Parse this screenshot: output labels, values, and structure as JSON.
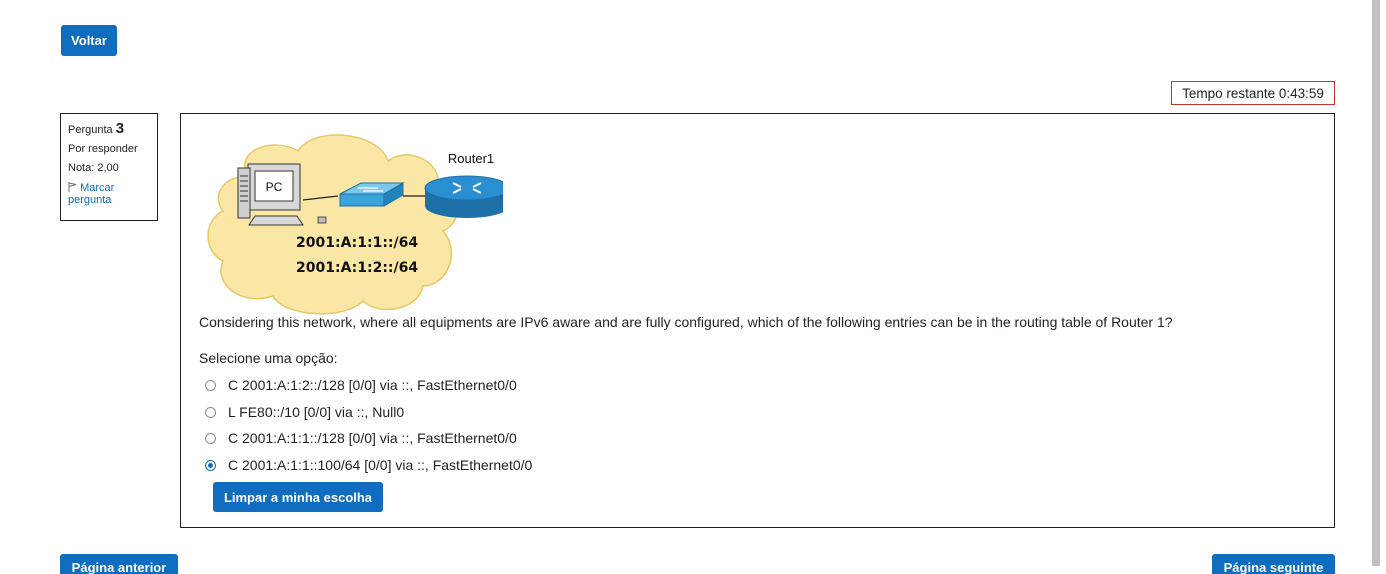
{
  "nav": {
    "back_label": "Voltar",
    "prev_label": "Página anterior",
    "next_label": "Página seguinte"
  },
  "timer": {
    "text": "Tempo restante 0:43:59"
  },
  "question_info": {
    "label": "Pergunta",
    "number": "3",
    "status": "Por responder",
    "grade": "Nota: 2,00",
    "flag_label": "Marcar pergunta",
    "flag_icon": "flag-outline-icon"
  },
  "diagram": {
    "router_label": "Router1",
    "pc_label": "PC",
    "network1": "2001:A:1:1::/64",
    "network2": "2001:A:1:2::/64",
    "cloud_color": "#fbe7a5",
    "switch_color": "#3aa3d9",
    "router_color": "#2a8fd0"
  },
  "question": {
    "text": "Considering this network, where all equipments are IPv6 aware and are fully configured, which of the following entries can be in the routing table of Router 1?",
    "prompt": "Selecione uma opção:",
    "options": [
      {
        "label": "C 2001:A:1:2::/128 [0/0] via ::, FastEthernet0/0",
        "selected": false
      },
      {
        "label": "L FE80::/10 [0/0] via ::, Null0",
        "selected": false
      },
      {
        "label": "C 2001:A:1:1::/128 [0/0] via ::, FastEthernet0/0",
        "selected": false
      },
      {
        "label": "C 2001:A:1:1::100/64 [0/0] via ::, FastEthernet0/0",
        "selected": true
      }
    ],
    "clear_label": "Limpar a minha escolha"
  },
  "colors": {
    "primary": "#0f6cbf",
    "timer_border": "#c0392b"
  }
}
